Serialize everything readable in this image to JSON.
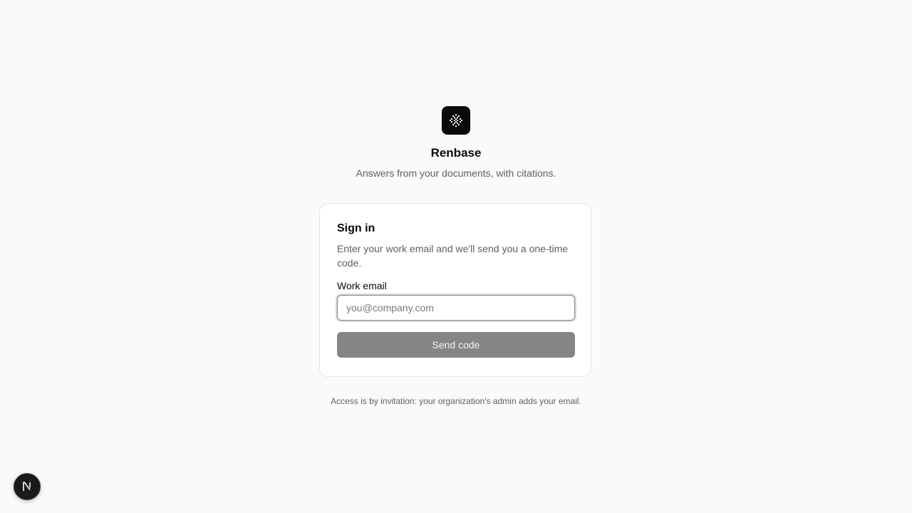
{
  "brand": {
    "logo_icon": "dotted-pattern-icon",
    "name": "Renbase",
    "tagline": "Answers from your documents, with citations."
  },
  "signin": {
    "title": "Sign in",
    "description": "Enter your work email and we'll send you a one-time code.",
    "email_label": "Work email",
    "email_value": "",
    "email_placeholder": "you@company.com",
    "submit_label": "Send code"
  },
  "footnote": "Access is by invitation: your organization's admin adds your email.",
  "dev_badge": {
    "icon": "nextjs-n-icon"
  },
  "colors": {
    "background": "#fafafa",
    "logo_bg": "#0a0a0a",
    "button_disabled": "#858585",
    "muted_text": "#5f5f5f"
  }
}
